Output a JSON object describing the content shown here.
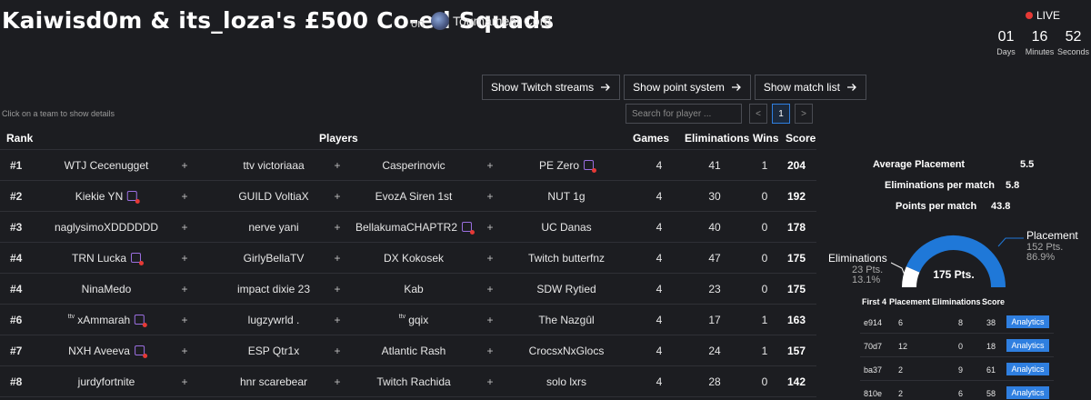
{
  "header": {
    "title": "Kaiwisd0m & its_loza's £500 Co-ed Squads",
    "on_label": "on",
    "org_name": "Tournament Cord",
    "live_label": "LIVE",
    "countdown": [
      {
        "value": "01",
        "label": "Days"
      },
      {
        "value": "16",
        "label": "Minutes"
      },
      {
        "value": "52",
        "label": "Seconds"
      }
    ]
  },
  "actions": {
    "twitch": "Show Twitch streams",
    "points": "Show point system",
    "matches": "Show match list"
  },
  "hint": "Click on a team to show details",
  "search": {
    "placeholder": "Search for player ..."
  },
  "pagination": {
    "prev": "<",
    "page": "1",
    "next": ">"
  },
  "table": {
    "headers": {
      "rank": "Rank",
      "players": "Players",
      "games": "Games",
      "elims": "Eliminations",
      "wins": "Wins",
      "score": "Score"
    },
    "plus": "+",
    "rows": [
      {
        "rank": "#1",
        "p": [
          {
            "n": "WTJ Cecenugget"
          },
          {
            "n": "ttv victoriaaa"
          },
          {
            "n": "Casperinovic"
          },
          {
            "n": "PE Zero",
            "tw": true
          }
        ],
        "games": "4",
        "elims": "41",
        "wins": "1",
        "score": "204"
      },
      {
        "rank": "#2",
        "p": [
          {
            "n": "Kiekie YN",
            "tw": true
          },
          {
            "n": "GUILD VoltiaX"
          },
          {
            "n": "EvozA Siren 1st"
          },
          {
            "n": "NUT 1g"
          }
        ],
        "games": "4",
        "elims": "30",
        "wins": "0",
        "score": "192"
      },
      {
        "rank": "#3",
        "p": [
          {
            "n": "naglysimoXDDDDDD"
          },
          {
            "n": "nerve yani"
          },
          {
            "n": "BellakumaCHAPTR2",
            "tw": true
          },
          {
            "n": "UC Danas"
          }
        ],
        "games": "4",
        "elims": "40",
        "wins": "0",
        "score": "178"
      },
      {
        "rank": "#4",
        "p": [
          {
            "n": "TRN Lucka",
            "tw": true
          },
          {
            "n": "GirlyBellaTV"
          },
          {
            "n": "DX Kokosek"
          },
          {
            "n": "Twitch butterfnz"
          }
        ],
        "games": "4",
        "elims": "47",
        "wins": "0",
        "score": "175"
      },
      {
        "rank": "#4",
        "p": [
          {
            "n": "NinaMedo"
          },
          {
            "n": "impact dixie 23"
          },
          {
            "n": "Kab"
          },
          {
            "n": "SDW Rytied"
          }
        ],
        "games": "4",
        "elims": "23",
        "wins": "0",
        "score": "175"
      },
      {
        "rank": "#6",
        "p": [
          {
            "n": "xAmmarah",
            "ttv": "ttv",
            "tw": true
          },
          {
            "n": "lugzywrld ."
          },
          {
            "n": "gqix",
            "ttv": "ttv"
          },
          {
            "n": "The Nazgûl"
          }
        ],
        "games": "4",
        "elims": "17",
        "wins": "1",
        "score": "163"
      },
      {
        "rank": "#7",
        "p": [
          {
            "n": "NXH Aveeva",
            "tw": true
          },
          {
            "n": "ESP Qtr1x"
          },
          {
            "n": "Atlantic Rash"
          },
          {
            "n": "CrocsxNxGlocs"
          }
        ],
        "games": "4",
        "elims": "24",
        "wins": "1",
        "score": "157"
      },
      {
        "rank": "#8",
        "p": [
          {
            "n": "jurdyfortnite"
          },
          {
            "n": "hnr scarebear"
          },
          {
            "n": "Twitch Rachida"
          },
          {
            "n": "solo lxrs"
          }
        ],
        "games": "4",
        "elims": "28",
        "wins": "0",
        "score": "142"
      }
    ]
  },
  "stats": {
    "avg_placement_label": "Average Placement",
    "avg_placement": "5.5",
    "elims_per_match_label": "Eliminations per match",
    "elims_per_match": "5.8",
    "points_per_match_label": "Points per match",
    "points_per_match": "43.8"
  },
  "breakdown": {
    "total": "175 Pts.",
    "placement": {
      "label": "Placement",
      "points": "152 Pts.",
      "pct": "86.9%",
      "fraction": 0.869
    },
    "elims": {
      "label": "Eliminations",
      "points": "23 Pts.",
      "pct": "13.1%",
      "fraction": 0.131
    },
    "colors": {
      "placement": "#1f78d8",
      "elims": "#ffffff"
    }
  },
  "first4": {
    "headers": {
      "match": "First 4",
      "placement": "Placement",
      "elims": "Eliminations",
      "score": "Score"
    },
    "analytics_label": "Analytics",
    "rows": [
      {
        "id": "e914",
        "placement": "6",
        "elims": "8",
        "score": "38"
      },
      {
        "id": "70d7",
        "placement": "12",
        "elims": "0",
        "score": "18"
      },
      {
        "id": "ba37",
        "placement": "2",
        "elims": "9",
        "score": "61"
      },
      {
        "id": "810e",
        "placement": "2",
        "elims": "6",
        "score": "58"
      }
    ]
  }
}
